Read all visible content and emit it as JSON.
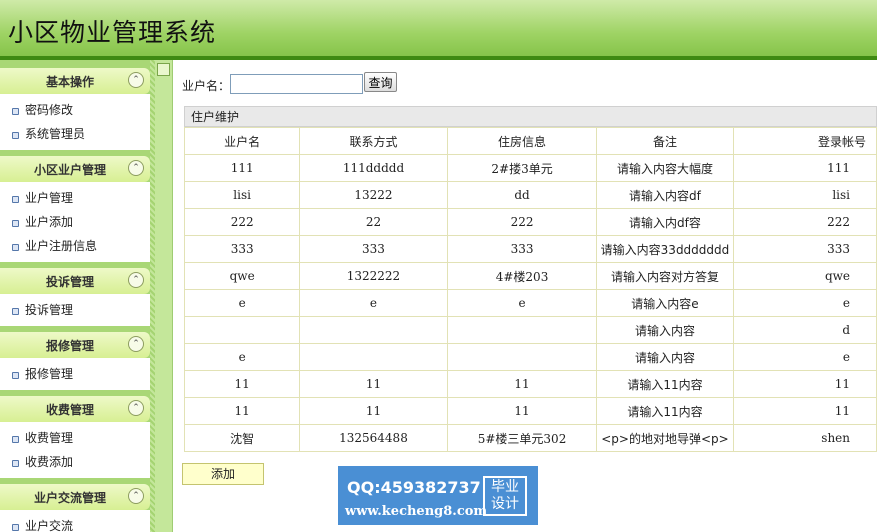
{
  "header": {
    "title": "小区物业管理系统"
  },
  "sidebar": {
    "sections": [
      {
        "title": "基本操作",
        "items": [
          "密码修改",
          "系统管理员"
        ]
      },
      {
        "title": "小区业户管理",
        "items": [
          "业户管理",
          "业户添加",
          "业户注册信息"
        ]
      },
      {
        "title": "投诉管理",
        "items": [
          "投诉管理"
        ]
      },
      {
        "title": "报修管理",
        "items": [
          "报修管理"
        ]
      },
      {
        "title": "收费管理",
        "items": [
          "收费管理",
          "收费添加"
        ]
      },
      {
        "title": "业户交流管理",
        "items": [
          "业户交流"
        ]
      }
    ],
    "toggle_glyph": "⌃"
  },
  "search": {
    "label": "业户名：",
    "value": "",
    "button": "查询"
  },
  "panel": {
    "title": "住户维护"
  },
  "table": {
    "columns": [
      "业户名",
      "联系方式",
      "住房信息",
      "备注",
      "登录帐号"
    ],
    "rows": [
      [
        "111",
        "111ddddd",
        "2#搂3单元",
        "请输入内容大幅度",
        "111"
      ],
      [
        "lisi",
        "13222",
        "dd",
        "请输入内容df",
        "lisi"
      ],
      [
        "222",
        "22",
        "222",
        "请输入内df容",
        "222"
      ],
      [
        "333",
        "333",
        "333",
        "请输入内容33ddddddd",
        "333"
      ],
      [
        "qwe",
        "1322222",
        "4#楼203",
        "请输入内容对方答复",
        "qwe"
      ],
      [
        "e",
        "e",
        "e",
        "请输入内容e",
        "e"
      ],
      [
        "",
        "",
        "",
        "请输入内容",
        "d"
      ],
      [
        "e",
        "",
        "",
        "请输入内容",
        "e"
      ],
      [
        "11",
        "11",
        "11",
        "请输入11内容",
        "11"
      ],
      [
        "11",
        "11",
        "11",
        "请输入11内容",
        "11"
      ],
      [
        "沈智",
        "132564488",
        "5#楼三单元302",
        "<p>的地对地导弹<p>",
        "shen"
      ]
    ]
  },
  "actions": {
    "add": "添加"
  },
  "watermark": {
    "qq": "QQ:459382737",
    "url": "www.kecheng8.com",
    "badge_line1": "毕业",
    "badge_line2": "设计"
  }
}
